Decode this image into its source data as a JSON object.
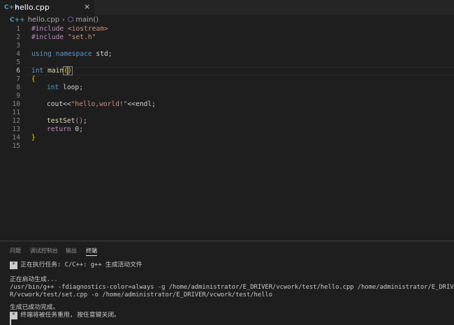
{
  "tab": {
    "icon": "C++",
    "label": "hello.cpp",
    "close": "×"
  },
  "breadcrumb": {
    "icon": "C++",
    "file": "hello.cpp",
    "sep": "›",
    "symbol_icon": "⬡",
    "symbol": "main()"
  },
  "editor": {
    "line_numbers": [
      "1",
      "2",
      "3",
      "4",
      "5",
      "6",
      "7",
      "8",
      "9",
      "10",
      "11",
      "12",
      "13",
      "14",
      "15"
    ],
    "code": {
      "l1_a": "#include ",
      "l1_b": "<iostream>",
      "l2_a": "#include ",
      "l2_b": "\"set.h\"",
      "l4_a": "using",
      "l4_b": " ",
      "l4_c": "namespace",
      "l4_d": " std;",
      "l6_a": "int",
      "l6_b": " ",
      "l6_c": "main",
      "l6_d": "(",
      "l6_e": ")",
      "l7": "{",
      "l8_a": "int",
      "l8_b": " loop;",
      "l10_a": "cout<<",
      "l10_b": "\"hello,world!\"",
      "l10_c": "<<endl;",
      "l12_a": "testSet",
      "l12_b": "()",
      "l12_c": ";",
      "l13_a": "return",
      "l13_b": " 0;",
      "l14": "}"
    }
  },
  "panel": {
    "tabs": [
      "问题",
      "调试控制台",
      "输出",
      "终端"
    ],
    "terminal": {
      "star": "*",
      "l1": "正在执行任务: C/C++: g++ 生成活动文件",
      "l2": "正在启动生成...",
      "l3": "/usr/bin/g++ -fdiagnostics-color=always -g /home/administrator/E_DRIVER/vcwork/test/hello.cpp /home/administrator/E_DRIVE",
      "l4": "R/vcwork/test/set.cpp -o /home/administrator/E_DRIVER/vcwork/test/hello",
      "l5": "生成已成功完成。",
      "l6": "终端将被任务重用, 按任意键关闭。"
    }
  },
  "colors": {
    "background": "#1e1e1e",
    "keyword": "#569cd6",
    "preprocessor": "#c586c0",
    "string": "#ce9178",
    "function": "#dcdcaa",
    "bracket": "#ffd700",
    "line_number": "#858585"
  }
}
